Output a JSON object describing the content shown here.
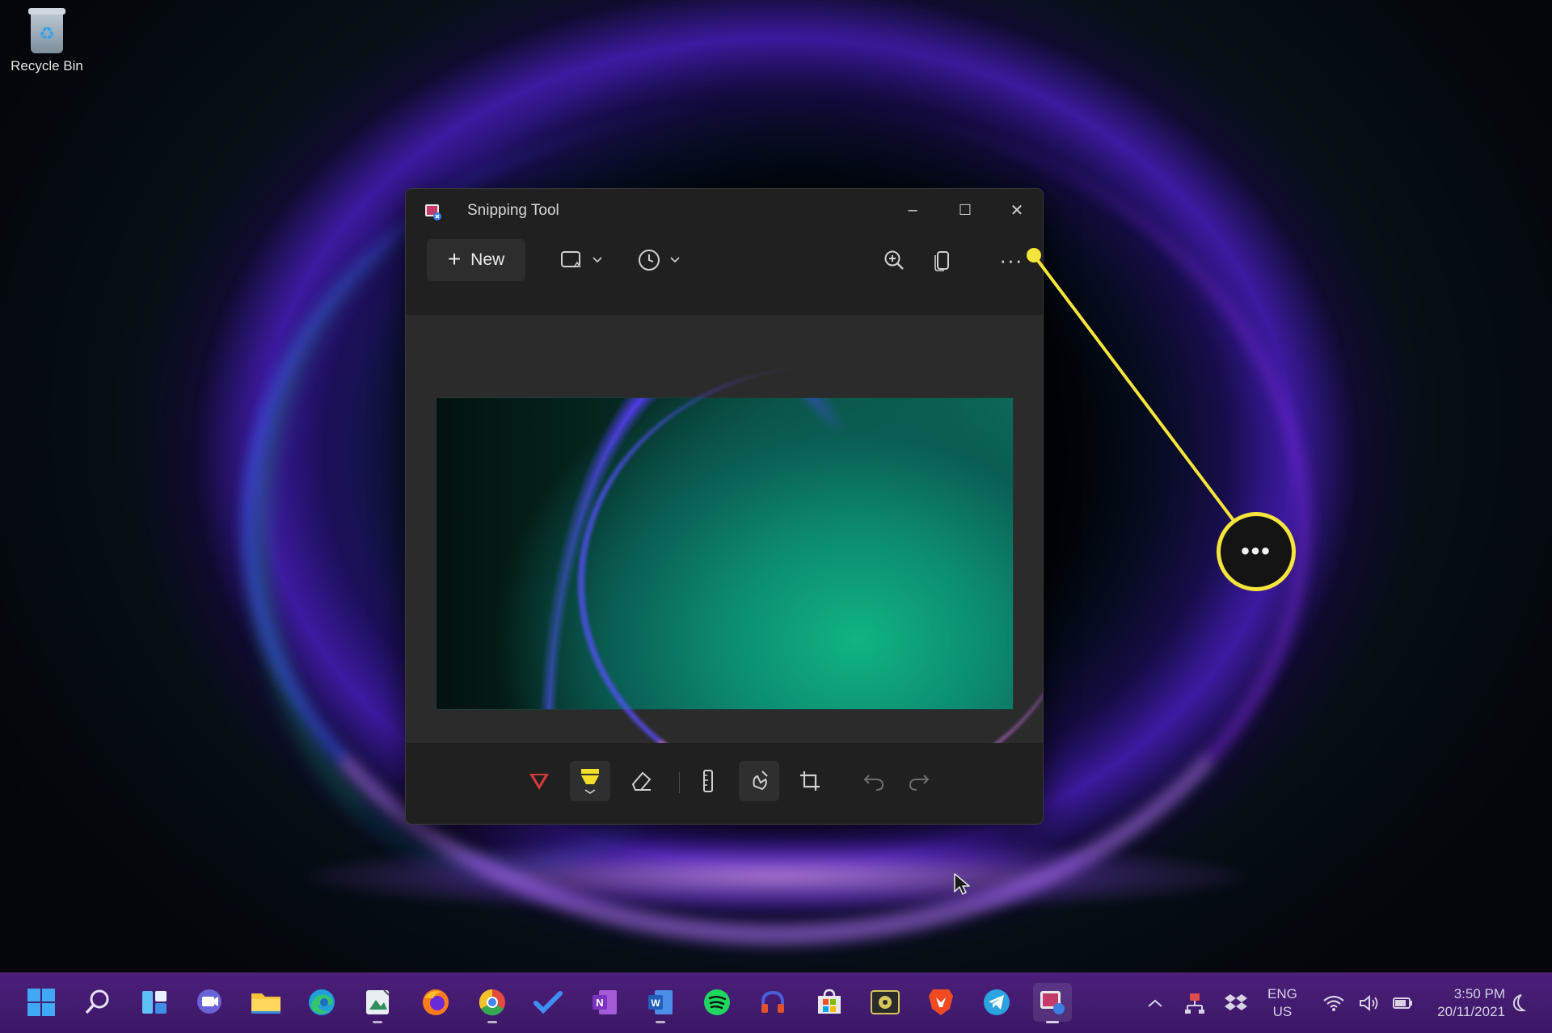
{
  "desktop": {
    "recycle_bin_label": "Recycle Bin"
  },
  "window": {
    "title": "Snipping Tool",
    "minimize_glyph": "–",
    "maximize_glyph": "☐",
    "close_glyph": "✕"
  },
  "toolbar": {
    "new_label": "New",
    "new_glyph": "+",
    "more_glyph": "···",
    "mode_icon": "rectangle-snip-icon",
    "delay_icon": "clock-icon",
    "zoom_icon": "zoom-in-icon",
    "copy_icon": "copy-icon"
  },
  "bottom_tools": [
    "ballpoint-pen-icon",
    "highlighter-icon",
    "eraser-icon",
    "ruler-icon",
    "touch-writing-icon",
    "crop-icon",
    "undo-icon",
    "redo-icon"
  ],
  "callout": {
    "glyph": "•••",
    "color": "#f5e43a"
  },
  "taskbar": {
    "apps": [
      "start-icon",
      "search-icon",
      "widgets-icon",
      "teams-chat-icon",
      "file-explorer-icon",
      "edge-icon",
      "photos-app-icon",
      "firefox-icon",
      "chrome-icon",
      "todo-icon",
      "onenote-icon",
      "word-icon",
      "spotify-icon",
      "headphones-app-icon",
      "store-icon",
      "media-app-icon",
      "brave-icon",
      "telegram-icon",
      "snipping-tool-taskbar-icon"
    ],
    "language_line1": "ENG",
    "language_line2": "US",
    "time": "3:50 PM",
    "date": "20/11/2021"
  },
  "colors": {
    "accent_callout": "#f5e43a",
    "taskbar": "#4b1f7a",
    "window_bg": "#202020"
  }
}
